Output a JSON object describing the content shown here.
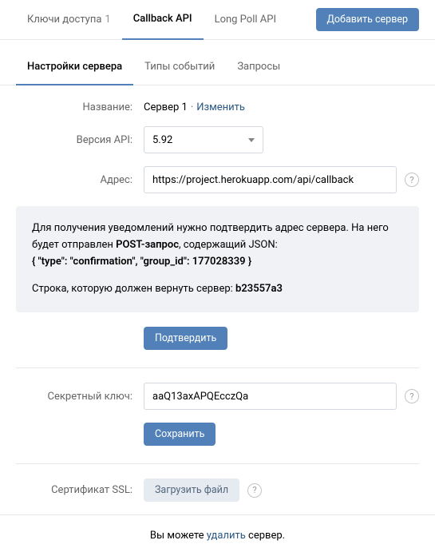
{
  "top_tabs": {
    "access_keys": {
      "label": "Ключи доступа",
      "count": "1"
    },
    "callback_api": {
      "label": "Callback API"
    },
    "long_poll": {
      "label": "Long Poll API"
    }
  },
  "add_server_btn": "Добавить сервер",
  "sub_tabs": {
    "settings": "Настройки сервера",
    "event_types": "Типы событий",
    "requests": "Запросы"
  },
  "labels": {
    "name": "Название:",
    "api_version": "Версия API:",
    "address": "Адрес:",
    "secret_key": "Секретный ключ:",
    "ssl_cert": "Сертификат SSL:"
  },
  "server": {
    "name": "Сервер 1",
    "change_link": "Изменить",
    "api_version": "5.92",
    "address": "https://project.herokuapp.com/api/callback",
    "secret_key": "aaQ13axAPQEcczQa"
  },
  "info": {
    "line1a": "Для получения уведомлений нужно подтвердить адрес сервера. На него будет отправлен ",
    "post_label": "POST-запрос",
    "line1b": ", содержащий JSON:",
    "json": "{ \"type\": \"confirmation\", \"group_id\": 177028339 }",
    "line2": "Строка, которую должен вернуть сервер: ",
    "code": "b23557a3"
  },
  "buttons": {
    "confirm": "Подтвердить",
    "save": "Сохранить",
    "upload": "Загрузить файл"
  },
  "footer": {
    "prefix": "Вы можете ",
    "delete_link": "удалить",
    "suffix": " сервер."
  }
}
